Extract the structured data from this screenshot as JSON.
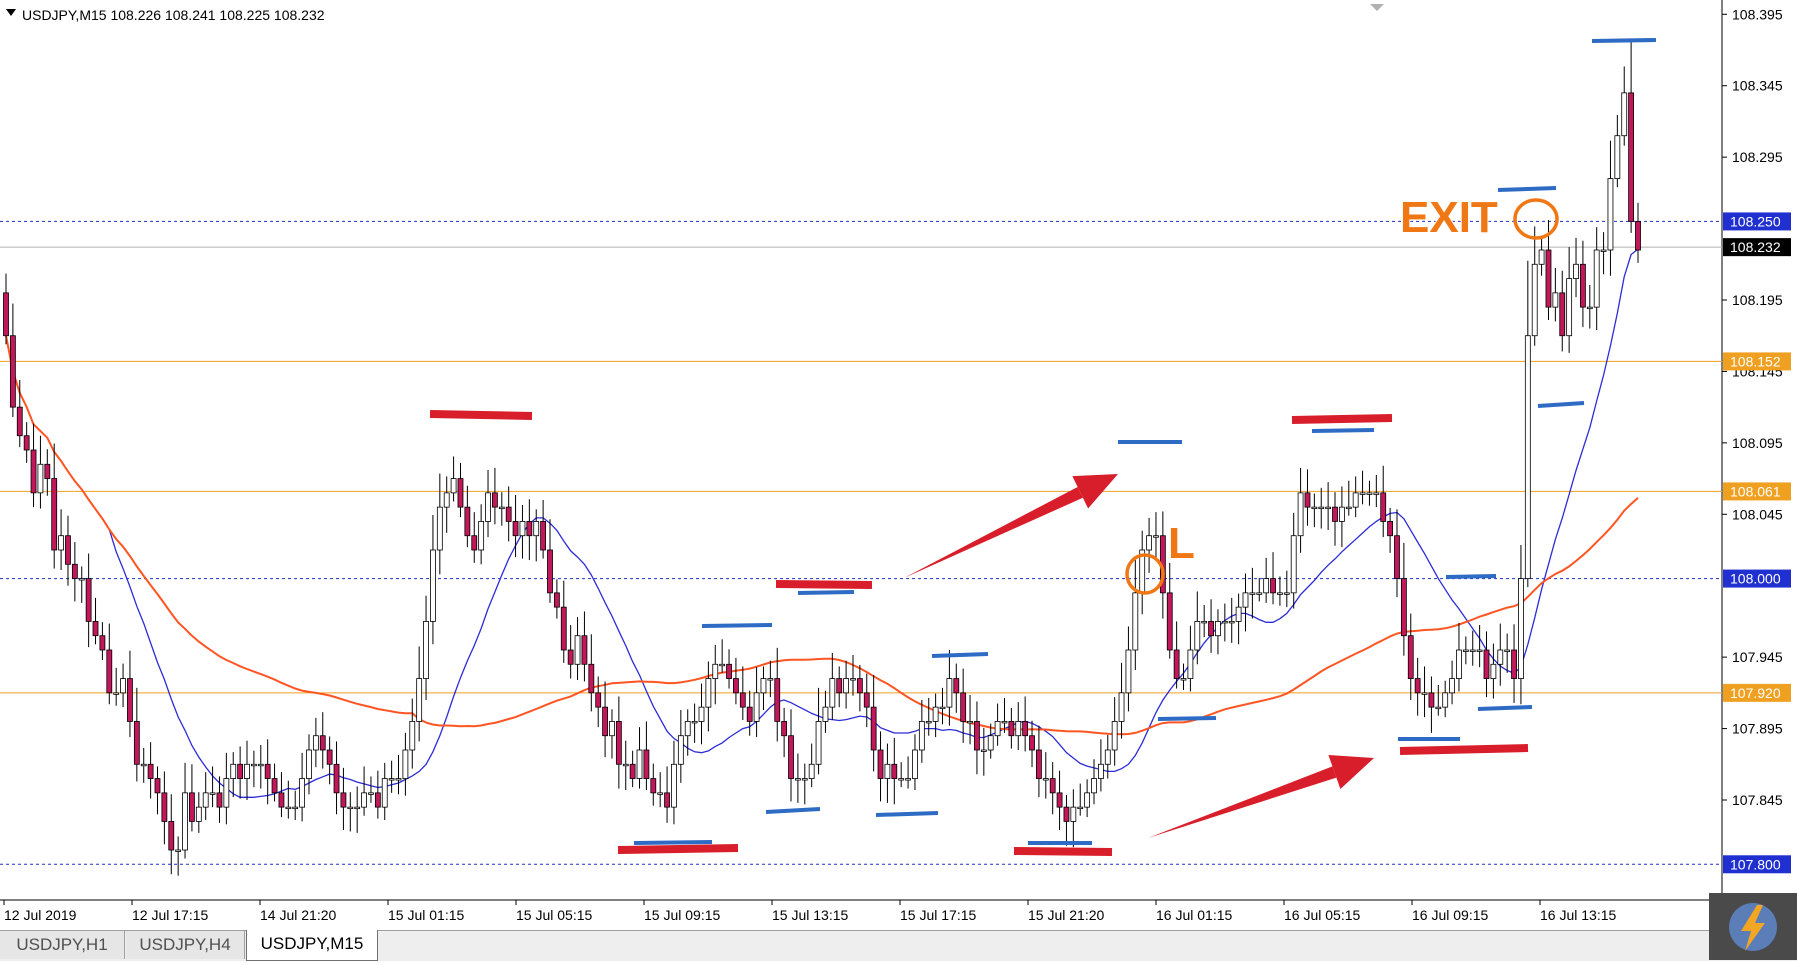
{
  "chart_data": {
    "type": "candlestick",
    "symbol_info": "USDJPY,M15  108.226 108.241 108.225 108.232",
    "ylim": [
      107.775,
      108.405
    ],
    "y_ticks": [
      "108.395",
      "108.345",
      "108.295",
      "108.195",
      "108.145",
      "108.095",
      "108.045",
      "107.945",
      "107.895",
      "107.845"
    ],
    "x_ticks": [
      "12 Jul 2019",
      "12 Jul 17:15",
      "14 Jul 21:20",
      "15 Jul 01:15",
      "15 Jul 05:15",
      "15 Jul 09:15",
      "15 Jul 13:15",
      "15 Jul 17:15",
      "15 Jul 21:20",
      "16 Jul 01:15",
      "16 Jul 05:15",
      "16 Jul 09:15",
      "16 Jul 13:15"
    ],
    "candle_close": [
      108.17,
      108.12,
      108.1,
      108.09,
      108.06,
      108.08,
      108.07,
      108.02,
      108.03,
      108.01,
      108.0,
      108.0,
      107.97,
      107.96,
      107.95,
      107.92,
      107.92,
      107.93,
      107.9,
      107.87,
      107.87,
      107.86,
      107.85,
      107.83,
      107.81,
      107.81,
      107.85,
      107.83,
      107.84,
      107.85,
      107.85,
      107.84,
      107.86,
      107.87,
      107.86,
      107.87,
      107.87,
      107.87,
      107.86,
      107.85,
      107.84,
      107.84,
      107.84,
      107.86,
      107.88,
      107.89,
      107.88,
      107.87,
      107.85,
      107.84,
      107.84,
      107.84,
      107.85,
      107.85,
      107.84,
      107.86,
      107.86,
      107.86,
      107.88,
      107.9,
      107.93,
      107.97,
      108.02,
      108.05,
      108.06,
      108.07,
      108.05,
      108.03,
      108.02,
      108.04,
      108.06,
      108.05,
      108.05,
      108.04,
      108.03,
      108.04,
      108.03,
      108.04,
      108.02,
      107.99,
      107.98,
      107.95,
      107.94,
      107.96,
      107.94,
      107.92,
      107.91,
      107.89,
      107.9,
      107.87,
      107.87,
      107.86,
      107.88,
      107.86,
      107.85,
      107.85,
      107.84,
      107.87,
      107.89,
      107.9,
      107.9,
      107.91,
      107.93,
      107.94,
      107.94,
      107.93,
      107.92,
      107.91,
      107.9,
      107.92,
      107.93,
      107.93,
      107.9,
      107.89,
      107.86,
      107.86,
      107.86,
      107.87,
      107.9,
      107.91,
      107.93,
      107.92,
      107.93,
      107.93,
      107.92,
      107.91,
      107.88,
      107.86,
      107.87,
      107.86,
      107.86,
      107.86,
      107.88,
      107.9,
      107.9,
      107.91,
      107.91,
      107.93,
      107.92,
      107.9,
      107.9,
      107.88,
      107.88,
      107.89,
      107.9,
      107.9,
      107.89,
      107.9,
      107.89,
      107.88,
      107.86,
      107.86,
      107.85,
      107.84,
      107.83,
      107.84,
      107.84,
      107.85,
      107.86,
      107.87,
      107.88,
      107.9,
      107.92,
      107.95,
      107.99,
      108.02,
      108.03,
      108.03,
      107.99,
      107.95,
      107.93,
      107.93,
      107.95,
      107.97,
      107.97,
      107.96,
      107.97,
      107.97,
      107.97,
      107.98,
      107.99,
      107.99,
      107.99,
      108.0,
      107.99,
      107.99,
      107.99,
      108.03,
      108.06,
      108.05,
      108.05,
      108.05,
      108.05,
      108.04,
      108.05,
      108.05,
      108.06,
      108.06,
      108.06,
      108.06,
      108.04,
      108.03,
      108.0,
      107.96,
      107.93,
      107.92,
      107.92,
      107.91,
      107.91,
      107.92,
      107.93,
      107.95,
      107.95,
      107.95,
      107.95,
      107.93,
      107.94,
      107.95,
      107.95,
      107.93,
      108.0,
      108.17,
      108.22,
      108.23,
      108.19,
      108.2,
      108.17,
      108.21,
      108.22,
      108.19,
      108.19,
      108.23,
      108.23,
      108.28,
      108.31,
      108.34,
      108.25,
      108.23
    ]
  },
  "price_lines": [
    {
      "label": "108.250",
      "color": "#2030d0"
    },
    {
      "label": "108.232",
      "color": "#000000"
    },
    {
      "label": "108.152",
      "color": "#f0a020"
    },
    {
      "label": "108.061",
      "color": "#f0a020"
    },
    {
      "label": "108.000",
      "color": "#2030d0"
    },
    {
      "label": "107.920",
      "color": "#f0a020"
    },
    {
      "label": "107.800",
      "color": "#2030d0"
    }
  ],
  "annotations": {
    "exit_label": "EXIT",
    "entry_label": "L"
  },
  "colors": {
    "bull_body": "#ffffff",
    "bear_body": "#c2185b",
    "ma_fast": "#2c2cd8",
    "ma_slow": "#ff5522",
    "zone_red": "#d91e2b",
    "zone_blue": "#2e6bc4",
    "label_orange": "#f07814"
  },
  "tabs": [
    "USDJPY,H1",
    "USDJPY,H4",
    "USDJPY,M15"
  ],
  "active_tab": "USDJPY,M15"
}
